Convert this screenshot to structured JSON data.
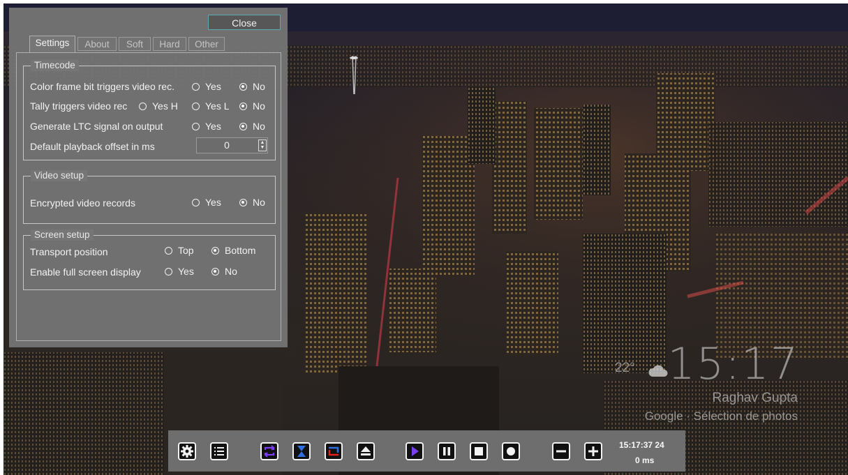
{
  "dialog": {
    "close_label": "Close",
    "tabs": [
      {
        "label": "Settings",
        "active": true
      },
      {
        "label": "About",
        "active": false
      },
      {
        "label": "Soft",
        "active": false
      },
      {
        "label": "Hard",
        "active": false
      },
      {
        "label": "Other",
        "active": false
      }
    ],
    "timecode": {
      "legend": "Timecode",
      "color_frame": {
        "label": "Color frame bit triggers video rec.",
        "options": [
          "Yes",
          "No"
        ],
        "selected": "No"
      },
      "tally": {
        "label": "Tally triggers video rec",
        "options": [
          "Yes H",
          "Yes L",
          "No"
        ],
        "selected": "No"
      },
      "ltc": {
        "label": "Generate LTC signal on output",
        "options": [
          "Yes",
          "No"
        ],
        "selected": "No"
      },
      "offset": {
        "label": "Default playback offset in ms",
        "value": "0"
      }
    },
    "video": {
      "legend": "Video setup",
      "encrypted": {
        "label": "Encrypted video records",
        "options": [
          "Yes",
          "No"
        ],
        "selected": "No"
      }
    },
    "screen": {
      "legend": "Screen setup",
      "transport": {
        "label": "Transport position",
        "options": [
          "Top",
          "Bottom"
        ],
        "selected": "Bottom"
      },
      "fullscreen": {
        "label": "Enable full screen display",
        "options": [
          "Yes",
          "No"
        ],
        "selected": "No"
      }
    }
  },
  "ambient": {
    "clock": "15:17",
    "temperature": "22°",
    "weather_icon": "cloud-icon",
    "photo_author": "Raghav Gupta",
    "photo_source": "Google · Sélection de photos"
  },
  "transport": {
    "buttons": [
      "gear-icon",
      "list-icon",
      "loop-icon",
      "hourglass-icon",
      "in-out-icon",
      "eject-icon",
      "play-icon",
      "pause-icon",
      "stop-icon",
      "record-icon",
      "minus-icon",
      "plus-icon"
    ],
    "timecode": "15:17:37 24",
    "offset": "0 ms",
    "colors": {
      "bar": "#6e6e6e",
      "button": "#111111",
      "accent_purple": "#7a3df0",
      "accent_blue": "#2f6fe0",
      "accent_red": "#e0201b"
    }
  }
}
